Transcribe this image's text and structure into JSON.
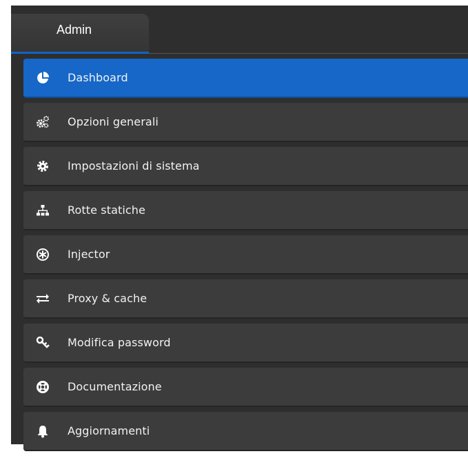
{
  "tabs": [
    {
      "label": "Admin",
      "active": true
    }
  ],
  "menu": {
    "items": [
      {
        "label": "Dashboard",
        "icon": "pie-chart-icon",
        "active": true
      },
      {
        "label": "Opzioni generali",
        "icon": "gears-icon",
        "active": false
      },
      {
        "label": "Impostazioni di sistema",
        "icon": "gear-icon",
        "active": false
      },
      {
        "label": "Rotte statiche",
        "icon": "sitemap-icon",
        "active": false
      },
      {
        "label": "Injector",
        "icon": "asterisk-circle-icon",
        "active": false
      },
      {
        "label": "Proxy & cache",
        "icon": "exchange-arrows-icon",
        "active": false
      },
      {
        "label": "Modifica password",
        "icon": "key-icon",
        "active": false
      },
      {
        "label": "Documentazione",
        "icon": "life-ring-icon",
        "active": false
      },
      {
        "label": "Aggiornamenti",
        "icon": "bell-icon",
        "active": false
      }
    ]
  },
  "colors": {
    "background": "#2e2e2e",
    "item": "#3c3c3c",
    "active": "#1667c7",
    "text": "#f2f2f2"
  }
}
